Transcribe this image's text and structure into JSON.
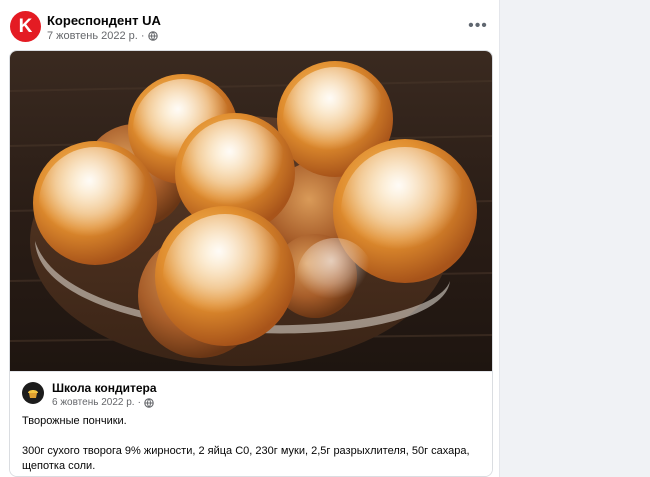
{
  "post": {
    "page_name": "Кореспондент UA",
    "logo_letter": "K",
    "date": "7 жовтень 2022 р.",
    "privacy_icon": "globe-icon",
    "more_icon": "more-icon",
    "more_label": "•••"
  },
  "shared_post": {
    "page_name": "Школа кондитера",
    "date": "6 жовтень 2022 р.",
    "privacy_icon": "globe-icon",
    "title": "Творожные пончики.",
    "ingredients_line1": "300г сухого творога 9% жирности, 2 яйца С0, 230г муки, 2,5г разрыхлителя, 50г сахара,",
    "ingredients_line2": "щепотка соли."
  },
  "colors": {
    "logo_red": "#e41b23",
    "secondary_text": "#65676b",
    "background": "#f0f2f5"
  }
}
